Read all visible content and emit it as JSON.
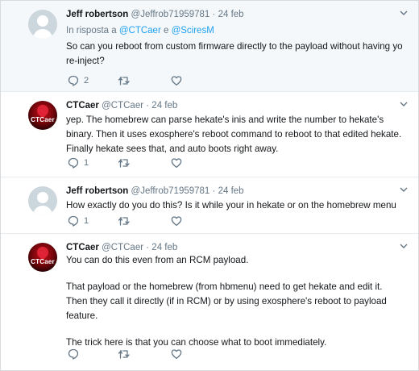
{
  "tweets": [
    {
      "name": "Jeff robertson",
      "handle": "@Jeffrob71959781",
      "dot": "·",
      "time": "24 feb",
      "reply_prefix": "In risposta a ",
      "reply_user1": "@CTCaer",
      "reply_conj": " e ",
      "reply_user2": "@SciresM",
      "text": "So can you reboot from custom firmware directly to the payload without having yo re-inject?",
      "reply_count": "2"
    },
    {
      "name": "CTCaer",
      "handle": "@CTCaer",
      "dot": "·",
      "time": "24 feb",
      "avatar_text": "CTCaer",
      "text": "yep. The homebrew can parse hekate's inis and write the number to hekate's binary. Then it uses exosphere's reboot command to reboot to that edited hekate. Finally hekate sees that, and auto boots right away.",
      "reply_count": "1"
    },
    {
      "name": "Jeff robertson",
      "handle": "@Jeffrob71959781",
      "dot": "·",
      "time": "24 feb",
      "text": "How exactly do you do this? Is it while your in hekate or on the homebrew menu",
      "reply_count": "1"
    },
    {
      "name": "CTCaer",
      "handle": "@CTCaer",
      "dot": "·",
      "time": "24 feb",
      "avatar_text": "CTCaer",
      "paragraphs": [
        "You can do this even from an RCM payload.",
        "That payload or the homebrew (from hbmenu) need to get hekate and edit it. Then they call it directly (if in RCM) or by using exosphere's reboot to payload feature.",
        "The trick here is that you can choose what to boot immediately."
      ]
    }
  ],
  "colors": {
    "accent": "#1da1f2",
    "secondary_text": "#657786",
    "selected_bg": "#f5f8fa",
    "thread_line": "#ccd6dd"
  }
}
